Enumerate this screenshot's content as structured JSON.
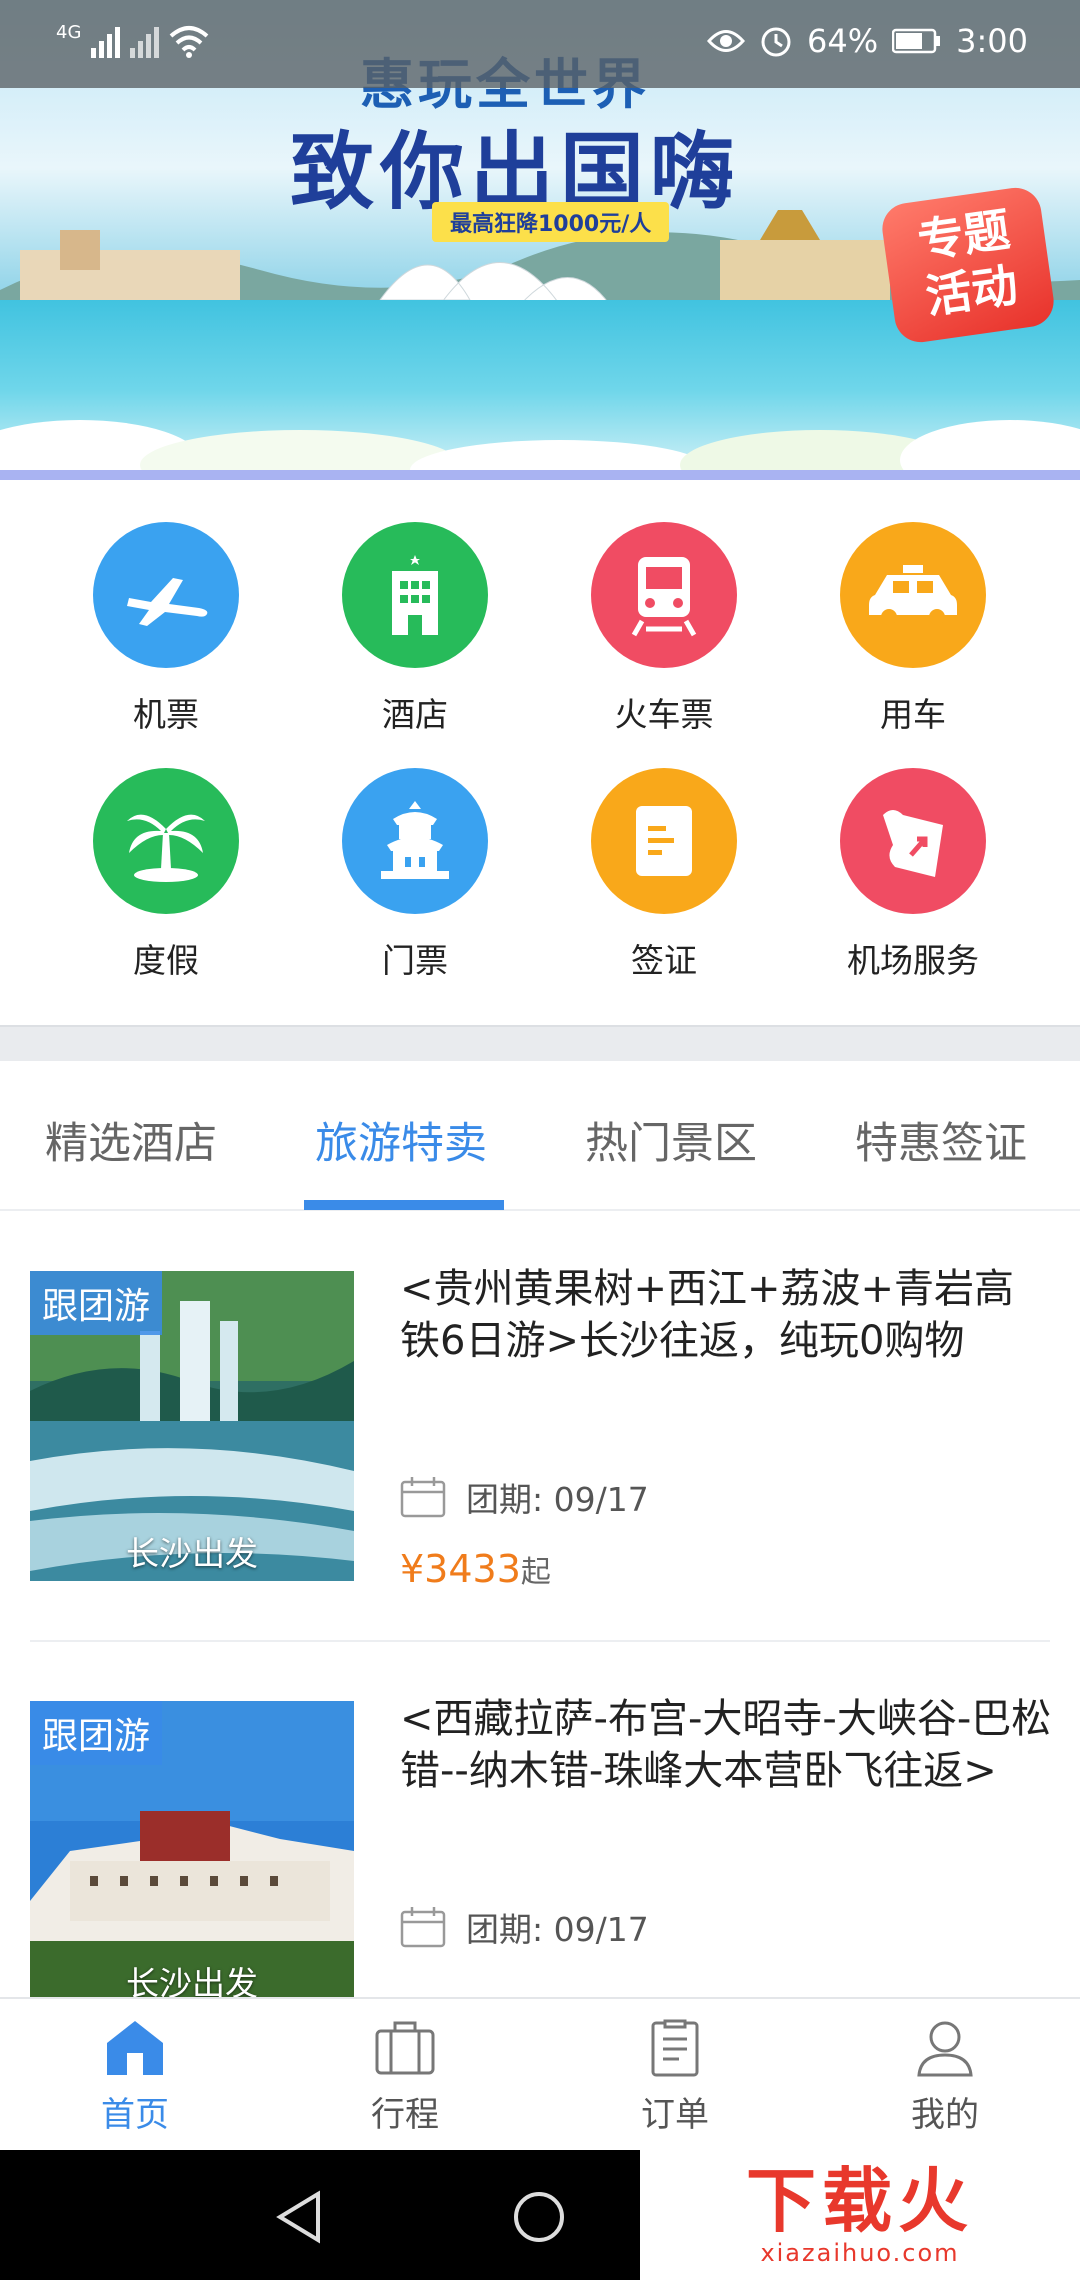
{
  "status_bar": {
    "network": "4G",
    "battery": "64%",
    "time": "3:00"
  },
  "banner": {
    "title_line1": "惠玩全世界",
    "title_line2": "致你出国嗨",
    "subtitle": "最高狂降1000元/人",
    "promo_line1": "专题",
    "promo_line2": "活动"
  },
  "categories": [
    {
      "label": "机票",
      "icon": "airplane-icon",
      "color": "#3aa2f0"
    },
    {
      "label": "酒店",
      "icon": "hotel-building-icon",
      "color": "#27bb5a"
    },
    {
      "label": "火车票",
      "icon": "train-icon",
      "color": "#f04c63"
    },
    {
      "label": "用车",
      "icon": "taxi-car-icon",
      "color": "#f9a81a"
    },
    {
      "label": "度假",
      "icon": "palm-tree-icon",
      "color": "#27bb5a"
    },
    {
      "label": "门票",
      "icon": "temple-icon",
      "color": "#3aa2f0"
    },
    {
      "label": "签证",
      "icon": "document-icon",
      "color": "#f9a81a"
    },
    {
      "label": "机场服务",
      "icon": "airport-service-icon",
      "color": "#f04c63"
    }
  ],
  "tabs": {
    "items": [
      "精选酒店",
      "旅游特卖",
      "热门景区",
      "特惠签证"
    ],
    "active_index": 1,
    "active_color": "#3a8be8"
  },
  "products": [
    {
      "tag": "跟团游",
      "origin": "长沙出发",
      "title": "<贵州黄果树+西江+荔波+青岩高铁6日游>长沙往返，纯玩0购物",
      "date_label": "团期: 09/17",
      "price": "¥3433",
      "price_suffix": "起"
    },
    {
      "tag": "跟团游",
      "origin": "长沙出发",
      "title": "<西藏拉萨-布宫-大昭寺-大峡谷-巴松错--纳木错-珠峰大本营卧飞往返>",
      "date_label": "团期: 09/17",
      "price": "",
      "price_suffix": ""
    }
  ],
  "bottom_nav": {
    "items": [
      {
        "label": "首页",
        "icon": "home-icon",
        "active": true
      },
      {
        "label": "行程",
        "icon": "briefcase-icon",
        "active": false
      },
      {
        "label": "订单",
        "icon": "clipboard-icon",
        "active": false
      },
      {
        "label": "我的",
        "icon": "user-icon",
        "active": false
      }
    ]
  },
  "watermark": {
    "main": "下载火",
    "sub": "xiazaihuo.com"
  }
}
